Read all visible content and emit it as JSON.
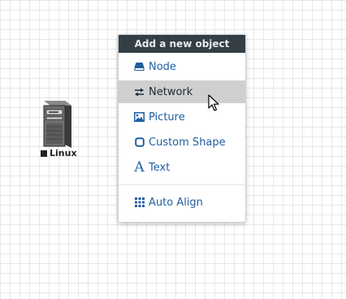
{
  "canvas": {
    "node": {
      "label": "Linux",
      "icon": "server-tower-icon"
    }
  },
  "menu": {
    "title": "Add a new object",
    "items": [
      {
        "label": "Node",
        "icon": "node-icon"
      },
      {
        "label": "Network",
        "icon": "network-arrows-icon",
        "state": "hovered"
      },
      {
        "label": "Picture",
        "icon": "picture-icon"
      },
      {
        "label": "Custom Shape",
        "icon": "custom-shape-icon"
      },
      {
        "label": "Text",
        "icon": "text-icon"
      }
    ],
    "footer_items": [
      {
        "label": "Auto Align",
        "icon": "grid-icon"
      }
    ]
  },
  "colors": {
    "menu_header_bg": "#343e45",
    "link_blue": "#1f5fa1",
    "hover_bg": "#cfcfcf"
  }
}
